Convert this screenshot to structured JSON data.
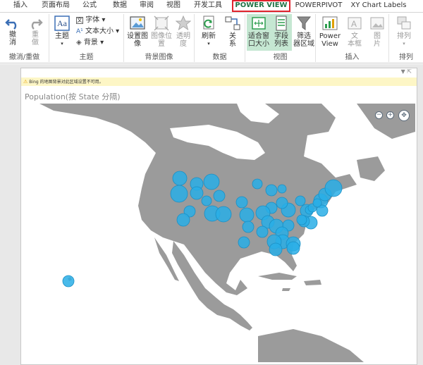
{
  "tabs": [
    {
      "label": "插入",
      "active": false
    },
    {
      "label": "页面布局",
      "active": false
    },
    {
      "label": "公式",
      "active": false
    },
    {
      "label": "数据",
      "active": false
    },
    {
      "label": "审阅",
      "active": false
    },
    {
      "label": "视图",
      "active": false
    },
    {
      "label": "开发工具",
      "active": false
    },
    {
      "label": "POWER VIEW",
      "active": true
    },
    {
      "label": "POWERPIVOT",
      "active": false
    },
    {
      "label": "XY Chart Labels",
      "active": false
    }
  ],
  "ribbon": {
    "undo": {
      "undo_label": "撤\n消",
      "redo_label": "重\n做",
      "group": "撤消/重做"
    },
    "theme": {
      "theme_label": "主题",
      "font_label": "字体",
      "text_size_label": "文本大小",
      "background_label": "背景",
      "group": "主题"
    },
    "bg_image": {
      "set_label": "设置图\n像",
      "position_label": "图像位\n置",
      "transparency_label": "透明\n度",
      "group": "背景图像"
    },
    "data": {
      "refresh_label": "刷新",
      "relations_label": "关\n系",
      "group": "数据"
    },
    "view": {
      "fit_label": "适合窗\n口大小",
      "field_list_label": "字段\n列表",
      "filter_area_label": "筛选\n器区域",
      "group": "视图"
    },
    "insert": {
      "power_view_label": "Power\nView",
      "textbox_label": "文\n本框",
      "picture_label": "图\n片",
      "group": "插入"
    },
    "arrange": {
      "arrange_label": "排列",
      "group": "排列"
    }
  },
  "warning": {
    "text": "Bing 的地图背景对此区域设置不可用。"
  },
  "view": {
    "title": "Population(按 State 分隔)"
  },
  "map": {
    "bubble_color": "#29aee6",
    "bubble_stroke": "#1b8fc4",
    "land_color": "#9b9b9b",
    "water_color": "#ffffff"
  },
  "colors": {
    "accent": "#217346",
    "highlight_border": "#e0242e"
  }
}
